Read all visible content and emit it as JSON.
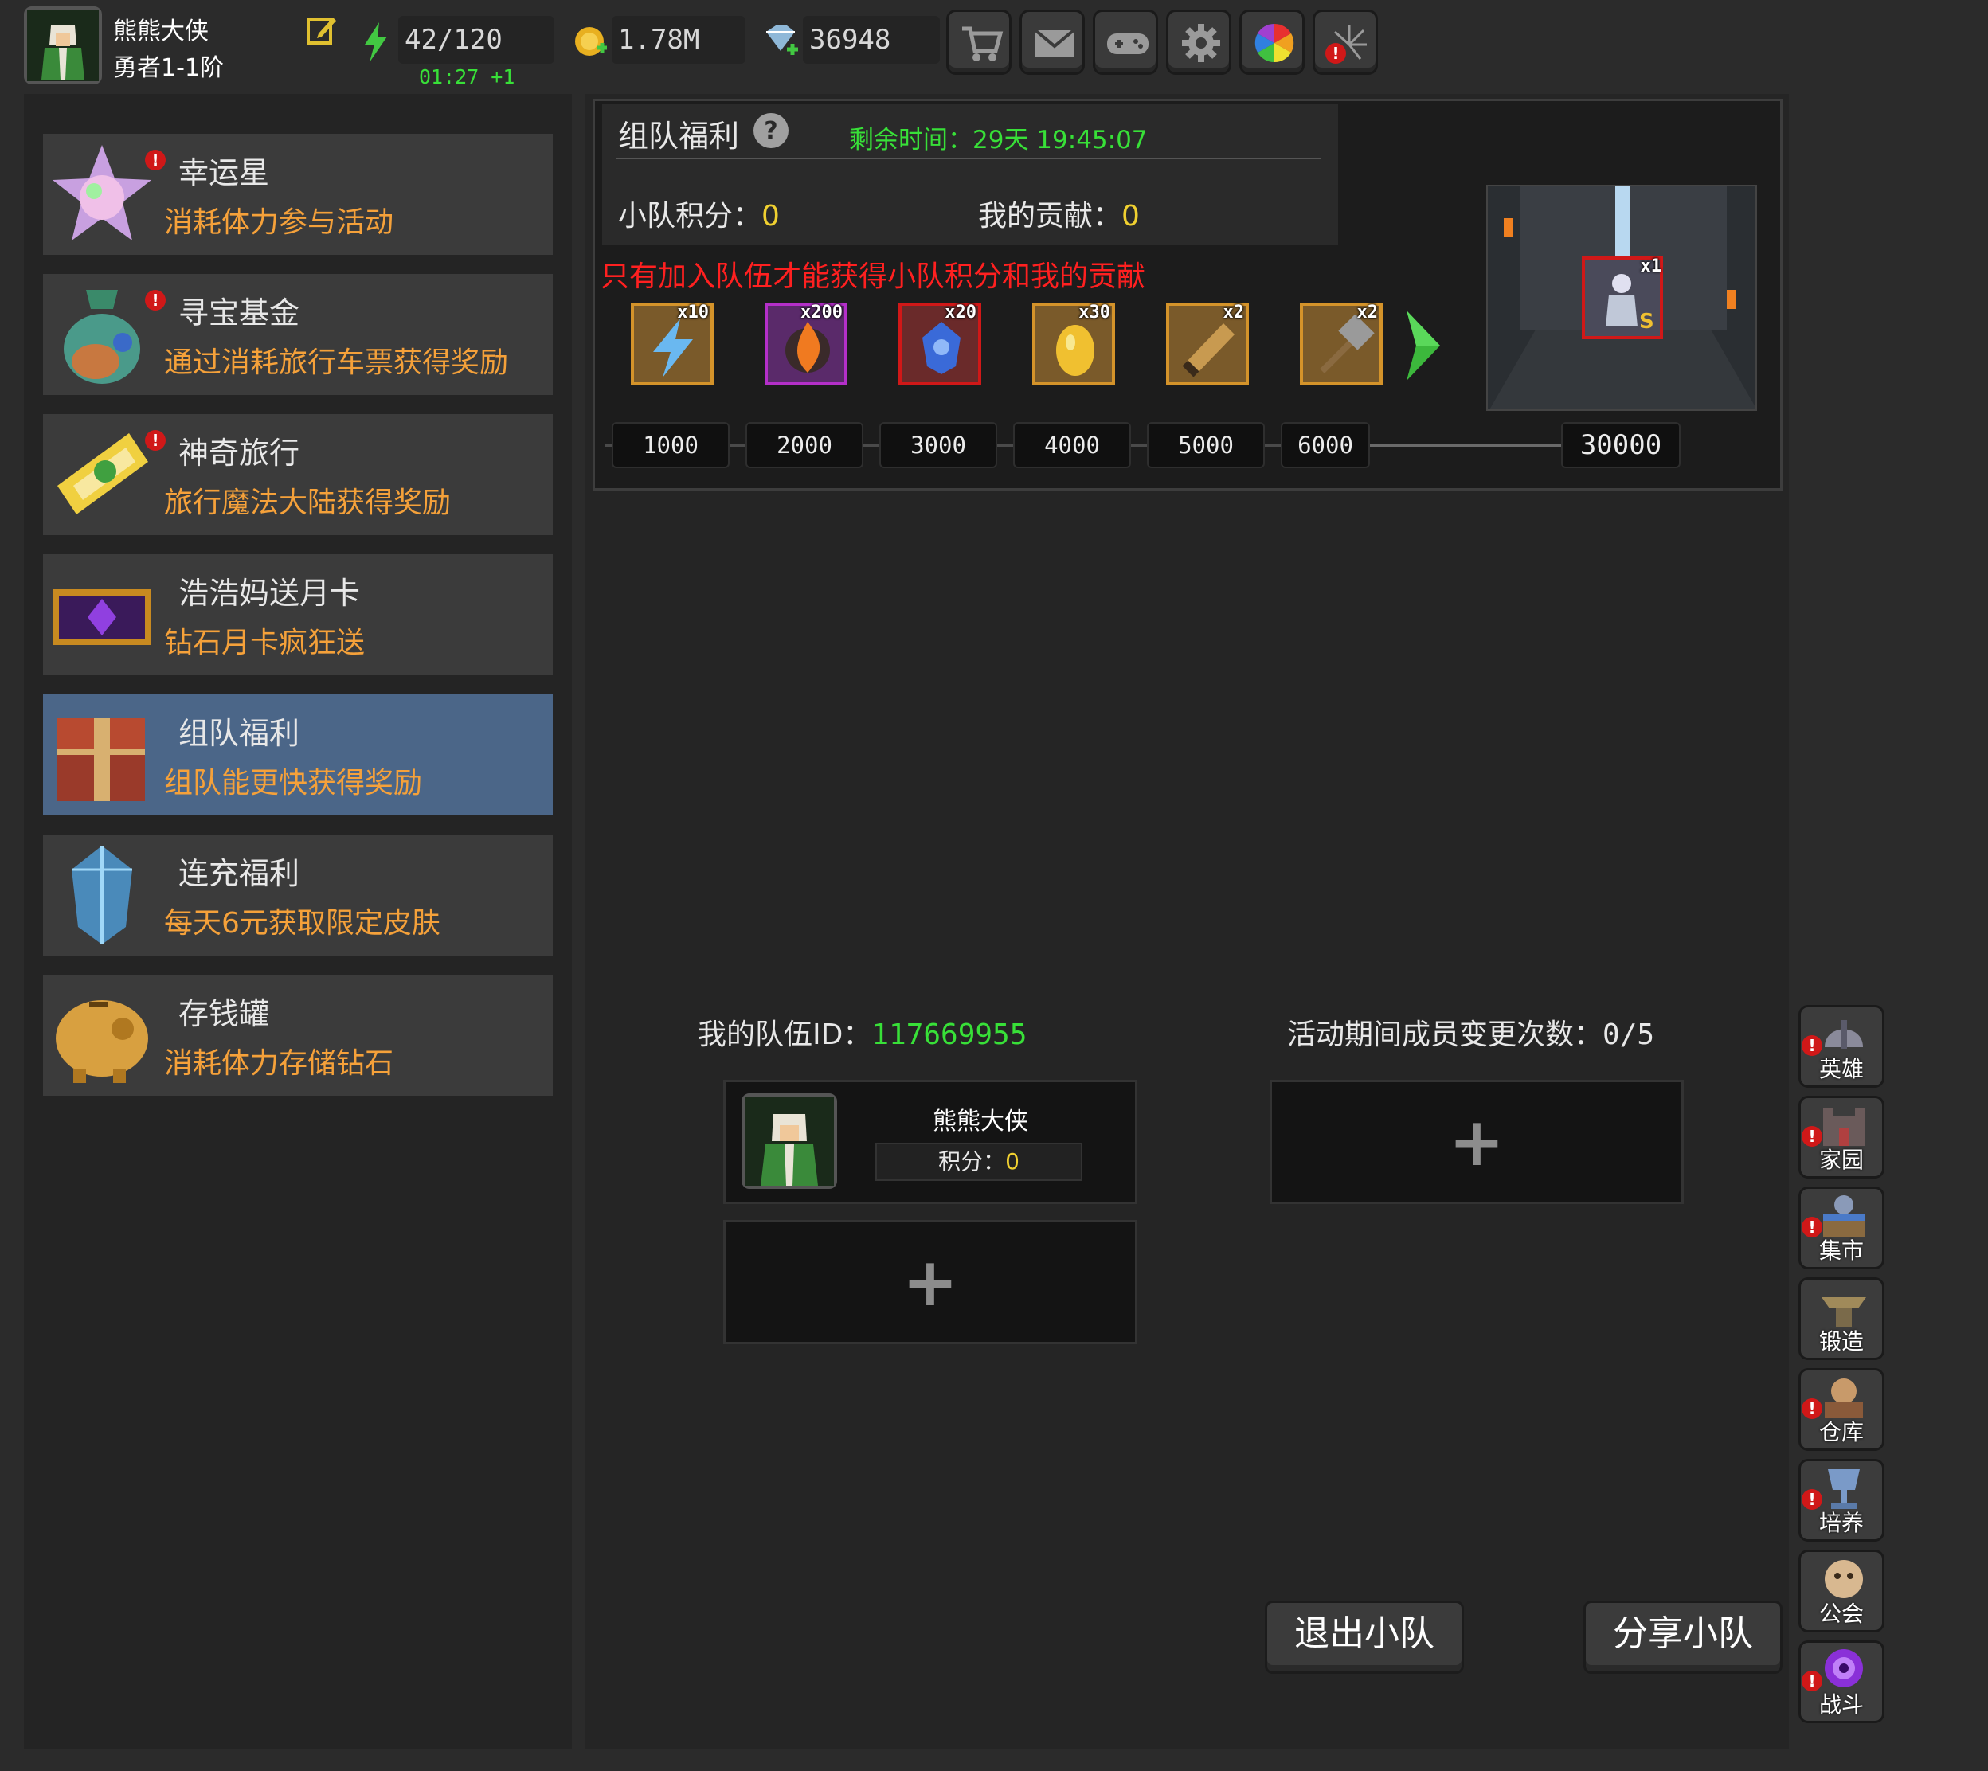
{
  "player": {
    "name": "熊熊大侠",
    "rank": "勇者1-1阶"
  },
  "resources": {
    "stamina": "42/120",
    "stamina_timer": "01:27 +1",
    "gold": "1.78M",
    "diamonds": "36948"
  },
  "toolbar": [
    {
      "icon": "cart-icon",
      "label": "shop"
    },
    {
      "icon": "mail-icon",
      "label": "mail"
    },
    {
      "icon": "gamepad-icon",
      "label": "games"
    },
    {
      "icon": "gear-icon",
      "label": "settings"
    },
    {
      "icon": "color-wheel-icon",
      "label": "palette"
    },
    {
      "icon": "firework-icon",
      "label": "events"
    }
  ],
  "sidebar": {
    "items": [
      {
        "title": "幸运星",
        "desc": "消耗体力参与活动",
        "icon": "lucky-star-icon",
        "alert": "!"
      },
      {
        "title": "寻宝基金",
        "desc": "通过消耗旅行车票获得奖励",
        "icon": "treasure-bag-icon",
        "alert": "!"
      },
      {
        "title": "神奇旅行",
        "desc": "旅行魔法大陆获得奖励",
        "icon": "travel-ticket-icon",
        "alert": "!"
      },
      {
        "title": "浩浩妈送月卡",
        "desc": "钻石月卡疯狂送",
        "icon": "month-card-icon",
        "alert": ""
      },
      {
        "title": "组队福利",
        "desc": "组队能更快获得奖励",
        "icon": "team-chest-icon",
        "alert": ""
      },
      {
        "title": "连充福利",
        "desc": "每天6元获取限定皮肤",
        "icon": "crystal-icon",
        "alert": ""
      },
      {
        "title": "存钱罐",
        "desc": "消耗体力存储钻石",
        "icon": "piggy-bank-icon",
        "alert": ""
      }
    ]
  },
  "event": {
    "title": "组队福利",
    "remaining_label": "剩余时间：",
    "remaining_value": "29天 19:45:07",
    "team_score_label": "小队积分：",
    "team_score_value": "0",
    "contribution_label": "我的贡献：",
    "contribution_value": "0",
    "warning": "只有加入队伍才能获得小队积分和我的贡献",
    "rewards": [
      {
        "icon": "lightning-icon",
        "count": "x10",
        "threshold": "1000",
        "color": "#d4932a"
      },
      {
        "icon": "flame-orb-icon",
        "count": "x200",
        "threshold": "2000",
        "color": "#b42fc9"
      },
      {
        "icon": "blue-crystal-icon",
        "count": "x20",
        "threshold": "3000",
        "color": "#d01818"
      },
      {
        "icon": "golden-egg-icon",
        "count": "x30",
        "threshold": "4000",
        "color": "#d4932a"
      },
      {
        "icon": "scroll-icon",
        "count": "x2",
        "threshold": "5000",
        "color": "#d4932a"
      },
      {
        "icon": "hammer-icon",
        "count": "x2",
        "threshold": "6000",
        "color": "#d4932a"
      }
    ],
    "grand_prize": {
      "icon": "hero-skin-icon",
      "count": "x1",
      "threshold": "30000"
    }
  },
  "team": {
    "id_label": "我的队伍ID：",
    "id_value": "117669955",
    "changes_label": "活动期间成员变更次数：",
    "changes_value": "0/5",
    "member": {
      "name": "熊熊大侠",
      "score_label": "积分：",
      "score_value": "0"
    },
    "add_symbol": "+",
    "leave_label": "退出小队",
    "share_label": "分享小队"
  },
  "rail": [
    {
      "label": "英雄",
      "icon": "helmet-icon",
      "alert": "!"
    },
    {
      "label": "家园",
      "icon": "castle-icon",
      "alert": "!"
    },
    {
      "label": "集市",
      "icon": "market-icon",
      "alert": "!"
    },
    {
      "label": "锻造",
      "icon": "anvil-icon",
      "alert": ""
    },
    {
      "label": "仓库",
      "icon": "warehouse-icon",
      "alert": "!"
    },
    {
      "label": "培养",
      "icon": "trophy-icon",
      "alert": "!"
    },
    {
      "label": "公会",
      "icon": "guild-icon",
      "alert": ""
    },
    {
      "label": "战斗",
      "icon": "portal-icon",
      "alert": "!"
    }
  ],
  "colors": {
    "accent_orange": "#f5a13a",
    "accent_green": "#38e038",
    "warning_red": "#ff2020",
    "active_item": "#4b6688"
  }
}
